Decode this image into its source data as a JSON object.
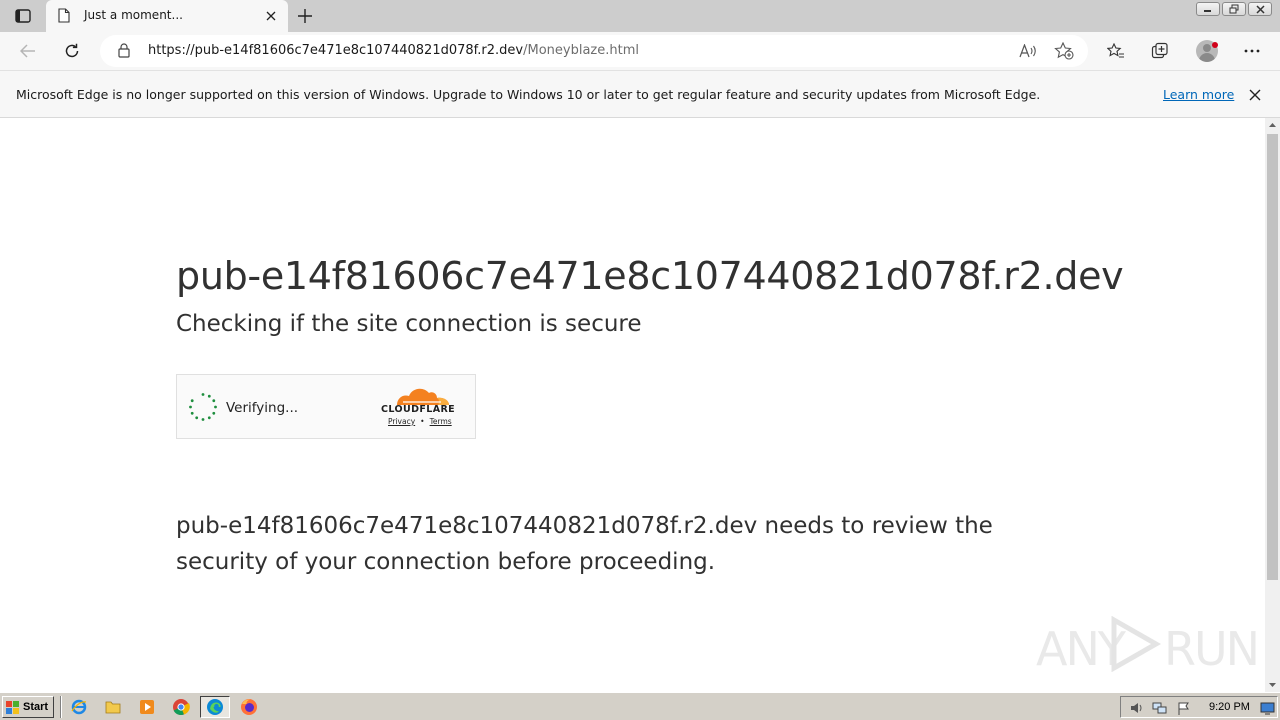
{
  "browser": {
    "tab": {
      "title": "Just a moment..."
    },
    "address": {
      "url_host": "https://pub-e14f81606c7e471e8c107440821d078f.r2.dev",
      "url_path": "/Moneyblaze.html"
    }
  },
  "infobar": {
    "message": "Microsoft Edge is no longer supported on this version of Windows. Upgrade to Windows 10 or later to get regular feature and security updates from Microsoft Edge.",
    "link": "Learn more"
  },
  "page": {
    "heading": "pub-e14f81606c7e471e8c107440821d078f.r2.dev",
    "subheading": "Checking if the site connection is secure",
    "widget": {
      "status": "Verifying...",
      "brand": "CLOUDFLARE",
      "privacy": "Privacy",
      "separator": "•",
      "terms": "Terms"
    },
    "paragraph": "pub-e14f81606c7e471e8c107440821d078f.r2.dev needs to review the security of your connection before proceeding."
  },
  "watermark": {
    "left": "ANY",
    "right": "RUN"
  },
  "taskbar": {
    "start_label": "Start",
    "clock": "9:20 PM"
  },
  "colors": {
    "cloudflare_orange": "#f48120",
    "cloudflare_light": "#faad3f",
    "spinner_green": "#1e8e3e",
    "link_blue": "#0067b8"
  }
}
